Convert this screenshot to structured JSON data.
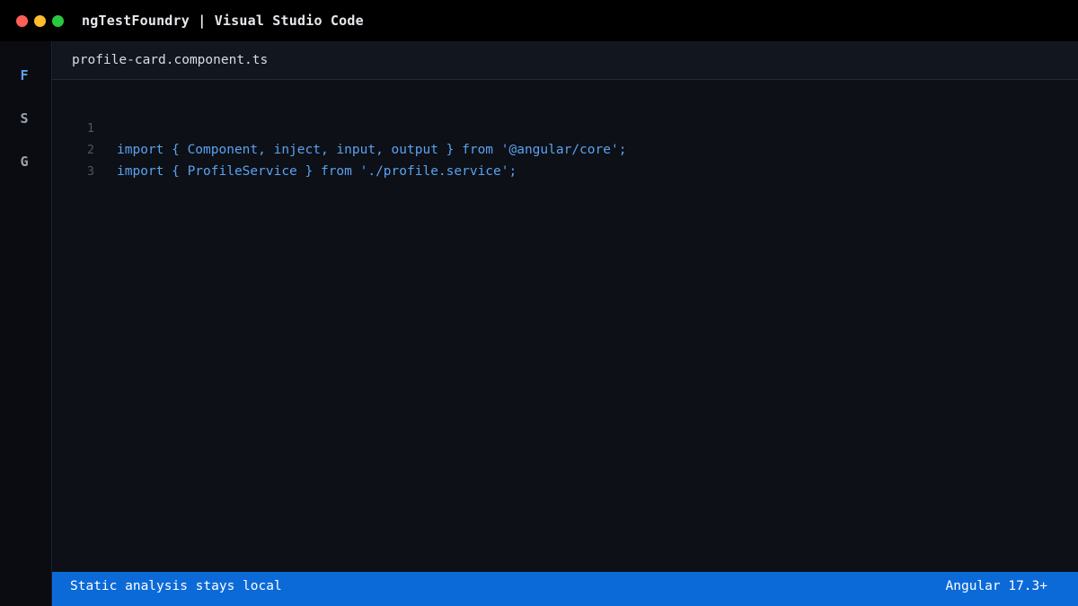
{
  "window": {
    "title": "ngTestFoundry | Visual Studio Code",
    "controls": [
      {
        "name": "close",
        "color": "#ff5f57"
      },
      {
        "name": "minimize",
        "color": "#febc2e"
      },
      {
        "name": "maximize",
        "color": "#28c840"
      }
    ]
  },
  "activity_bar": {
    "items": [
      {
        "label": "F",
        "active": true
      },
      {
        "label": "S",
        "active": false
      },
      {
        "label": "G",
        "active": false
      }
    ]
  },
  "tabs": [
    {
      "label": "profile-card.component.ts",
      "active": true
    }
  ],
  "editor": {
    "lines": [
      {
        "number": "1",
        "text": "import { Component, inject, input, output } from '@angular/core';"
      },
      {
        "number": "2",
        "text": "import { ProfileService } from './profile.service';"
      },
      {
        "number": "3",
        "text": ""
      }
    ]
  },
  "status_bar": {
    "left": "Static analysis stays local",
    "right": "Angular 17.3+"
  },
  "colors": {
    "accent": "#5aa2f0",
    "status_bar": "#0b6ad8",
    "titlebar": "#000000"
  }
}
